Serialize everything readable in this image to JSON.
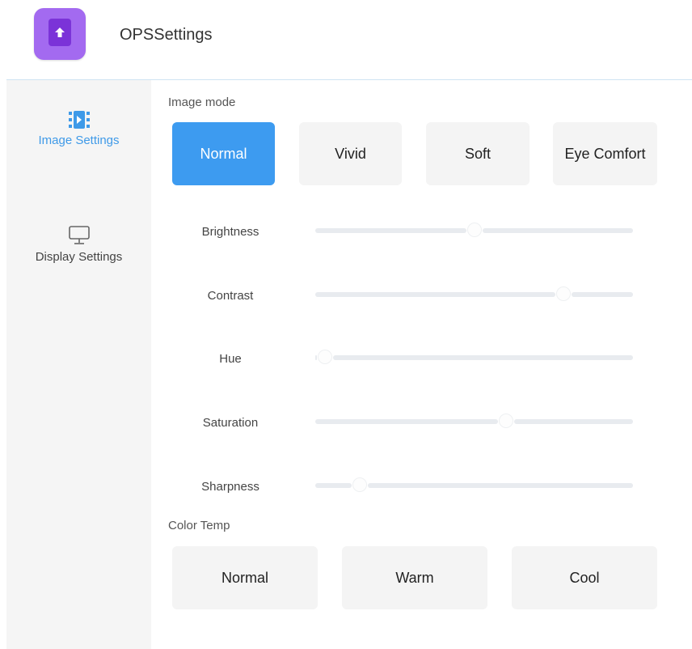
{
  "app": {
    "title": "OPSSettings",
    "icon": "app-upload-icon",
    "accent": "#a36af0"
  },
  "sidebar": {
    "items": [
      {
        "label": "Image Settings",
        "icon": "image-settings-icon",
        "active": true,
        "color": "#3f9ae8"
      },
      {
        "label": "Display Settings",
        "icon": "monitor-icon",
        "active": false
      }
    ]
  },
  "image_mode": {
    "label": "Image mode",
    "options": [
      "Normal",
      "Vivid",
      "Soft",
      "Eye Comfort"
    ],
    "selected": "Normal",
    "active_color": "#3d9bf0"
  },
  "sliders": [
    {
      "label": "Brightness",
      "value": 50
    },
    {
      "label": "Contrast",
      "value": 78
    },
    {
      "label": "Hue",
      "value": 3
    },
    {
      "label": "Saturation",
      "value": 60
    },
    {
      "label": "Sharpness",
      "value": 14
    }
  ],
  "color_temp": {
    "label": "Color Temp",
    "options": [
      "Normal",
      "Warm",
      "Cool"
    ]
  }
}
